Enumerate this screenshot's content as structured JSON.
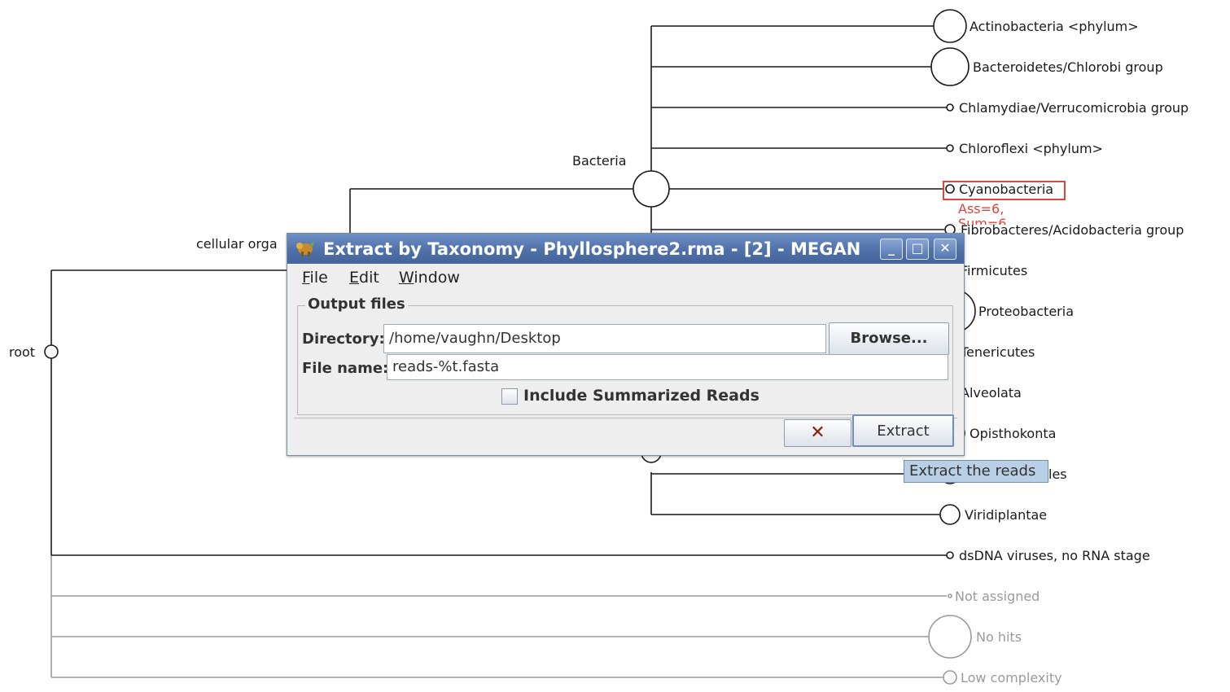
{
  "tree": {
    "root_label": "root",
    "cellular_label": "cellular orga",
    "bacteria_label": "Bacteria",
    "leaves": [
      {
        "id": "actino",
        "label": "Actinobacteria <phylum>"
      },
      {
        "id": "bacteroidetes",
        "label": "Bacteroidetes/Chlorobi group"
      },
      {
        "id": "chlamydiae",
        "label": "Chlamydiae/Verrucomicrobia group"
      },
      {
        "id": "chloroflexi",
        "label": "Chloroflexi <phylum>"
      },
      {
        "id": "cyanobacteria",
        "label": "Cyanobacteria"
      },
      {
        "id": "fibrobacteres",
        "label": "Fibrobacteres/Acidobacteria group"
      },
      {
        "id": "firmicutes",
        "label": "Firmicutes"
      },
      {
        "id": "proteobacteria",
        "label": "Proteobacteria"
      },
      {
        "id": "tenericutes",
        "label": "Tenericutes"
      },
      {
        "id": "alveolata",
        "label": "Alveolata"
      },
      {
        "id": "opisthokonta",
        "label": "Opisthokonta"
      },
      {
        "id": "les",
        "label": "les"
      },
      {
        "id": "viridiplantae",
        "label": "Viridiplantae"
      },
      {
        "id": "dsdna",
        "label": "dsDNA viruses, no RNA stage"
      },
      {
        "id": "notassigned",
        "label": "Not assigned"
      },
      {
        "id": "nohits",
        "label": "No hits"
      },
      {
        "id": "lowcomplexity",
        "label": "Low complexity"
      }
    ],
    "selected_annotation": [
      "Ass=6,",
      "Sum=6"
    ],
    "colors": {
      "line": "#1a1a1a",
      "grey": "#9a9a9a",
      "highlight": "#e0443a"
    }
  },
  "dialog": {
    "title": "Extract by Taxonomy - Phyllosphere2.rma - [2] - MEGAN",
    "window_buttons": {
      "minimize": "_",
      "maximize": "□",
      "close": "✕"
    },
    "menu": [
      {
        "first": "F",
        "rest": "ile"
      },
      {
        "first": "E",
        "rest": "dit"
      },
      {
        "first": "W",
        "rest": "indow"
      }
    ],
    "section_title": "Output files",
    "directory_label": "Directory:",
    "directory_value": "/home/vaughn/Desktop",
    "browse_label": "Browse...",
    "filename_label": "File name:",
    "filename_value": "reads-%t.fasta",
    "checkbox_label": "Include Summarized Reads",
    "checkbox_checked": false,
    "cancel_icon": "✕",
    "extract_label": "Extract",
    "tooltip": "Extract the reads",
    "colors": {
      "titlebar": "#5577b0",
      "background": "#eeeeee",
      "cancel_icon": "#8b1a10"
    }
  }
}
